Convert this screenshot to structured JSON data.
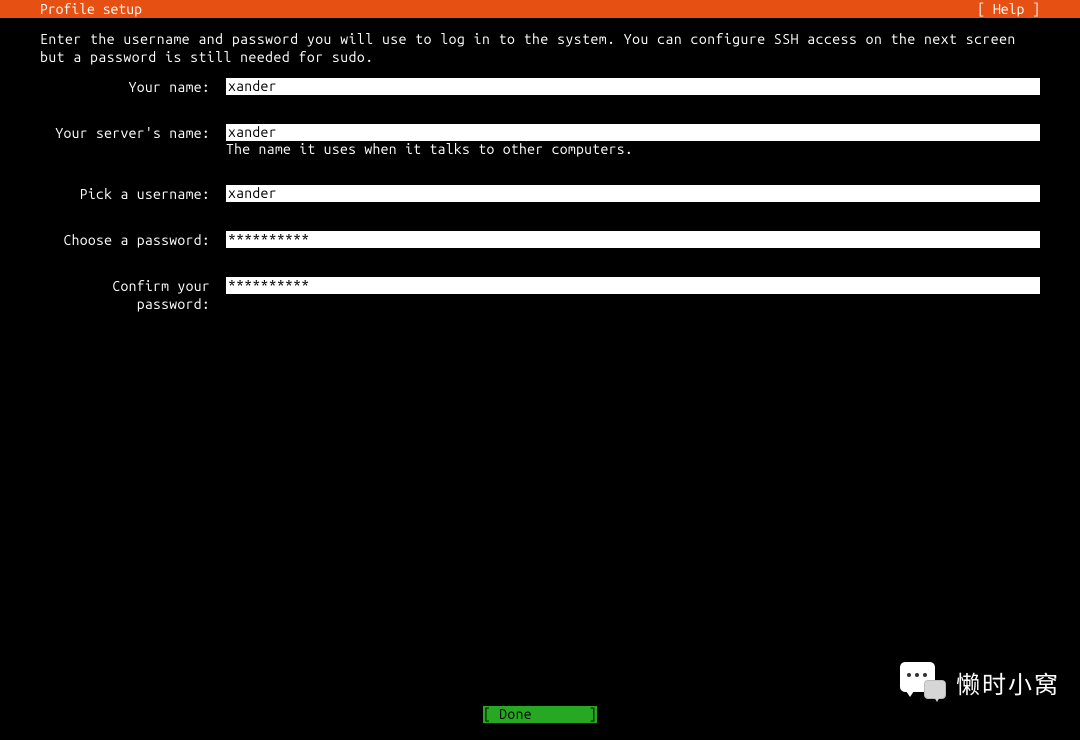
{
  "header": {
    "title": "Profile setup",
    "help_label": "[ Help ]"
  },
  "instructions": "Enter the username and password you will use to log in to the system. You can configure SSH access on the next screen but a password is still needed for sudo.",
  "form": {
    "your_name": {
      "label": "Your name:",
      "value": "xander"
    },
    "server_name": {
      "label": "Your server's name:",
      "value": "xander",
      "hint": "The name it uses when it talks to other computers."
    },
    "username": {
      "label": "Pick a username:",
      "value": "xander"
    },
    "password": {
      "label": "Choose a password:",
      "value": "**********"
    },
    "confirm_password": {
      "label": "Confirm your password:",
      "value": "**********"
    }
  },
  "footer": {
    "done_label": "[ Done       ]"
  },
  "watermark": {
    "text": "懒时小窝"
  },
  "colors": {
    "header_bg": "#E75013",
    "body_bg": "#000000",
    "input_bg": "#ffffff",
    "done_bg": "#26a822"
  }
}
